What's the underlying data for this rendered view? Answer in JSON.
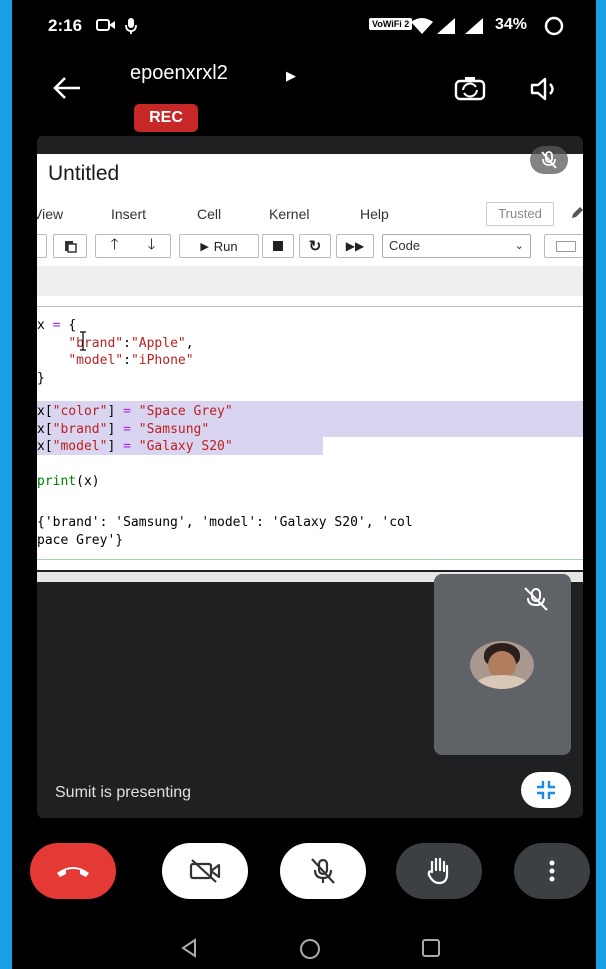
{
  "status_bar": {
    "time": "2:16",
    "network": "VoWiFi 2",
    "battery": "34%"
  },
  "header": {
    "room_name": "epoenxrxl2",
    "rec_label": "REC"
  },
  "notebook": {
    "title": "Untitled",
    "menu": [
      "View",
      "Insert",
      "Cell",
      "Kernel",
      "Help"
    ],
    "trusted_label": "Trusted",
    "run_label": "Run",
    "cell_type": "Code",
    "code_lines": {
      "l1_var": "x",
      "l1_op": "=",
      "l1_brace": "{",
      "l2_key": "\"brand\"",
      "l2_val": "\"Apple\"",
      "l3_key": "\"model\"",
      "l3_val": "\"iPhone\"",
      "l4_brace": "}",
      "l5_key": "\"color\"",
      "l5_val": "\"Space Grey\"",
      "l6_key": "\"brand\"",
      "l6_val": "\"Samsung\"",
      "l7_key": "\"model\"",
      "l7_val": "\"Galaxy S20\"",
      "l8_fn": "print",
      "l8_arg": "(x)"
    },
    "output_line1": "{'brand': 'Samsung', 'model': 'Galaxy S20', 'col",
    "output_line2": "pace Grey'}"
  },
  "presenter_caption": "Sumit is presenting",
  "icons": {
    "back": "arrow-left-icon",
    "room_arrow": "play-arrow-icon",
    "camera_switch": "camera-switch-icon",
    "speaker": "speaker-icon",
    "end_call": "phone-hangup-icon",
    "camera_off": "videocam-off-icon",
    "mic_off": "mic-off-icon",
    "raise_hand": "hand-icon",
    "more": "more-vert-icon"
  },
  "colors": {
    "rec": "#c62828",
    "end_call": "#e53935",
    "frame": "#1a9ee6"
  }
}
